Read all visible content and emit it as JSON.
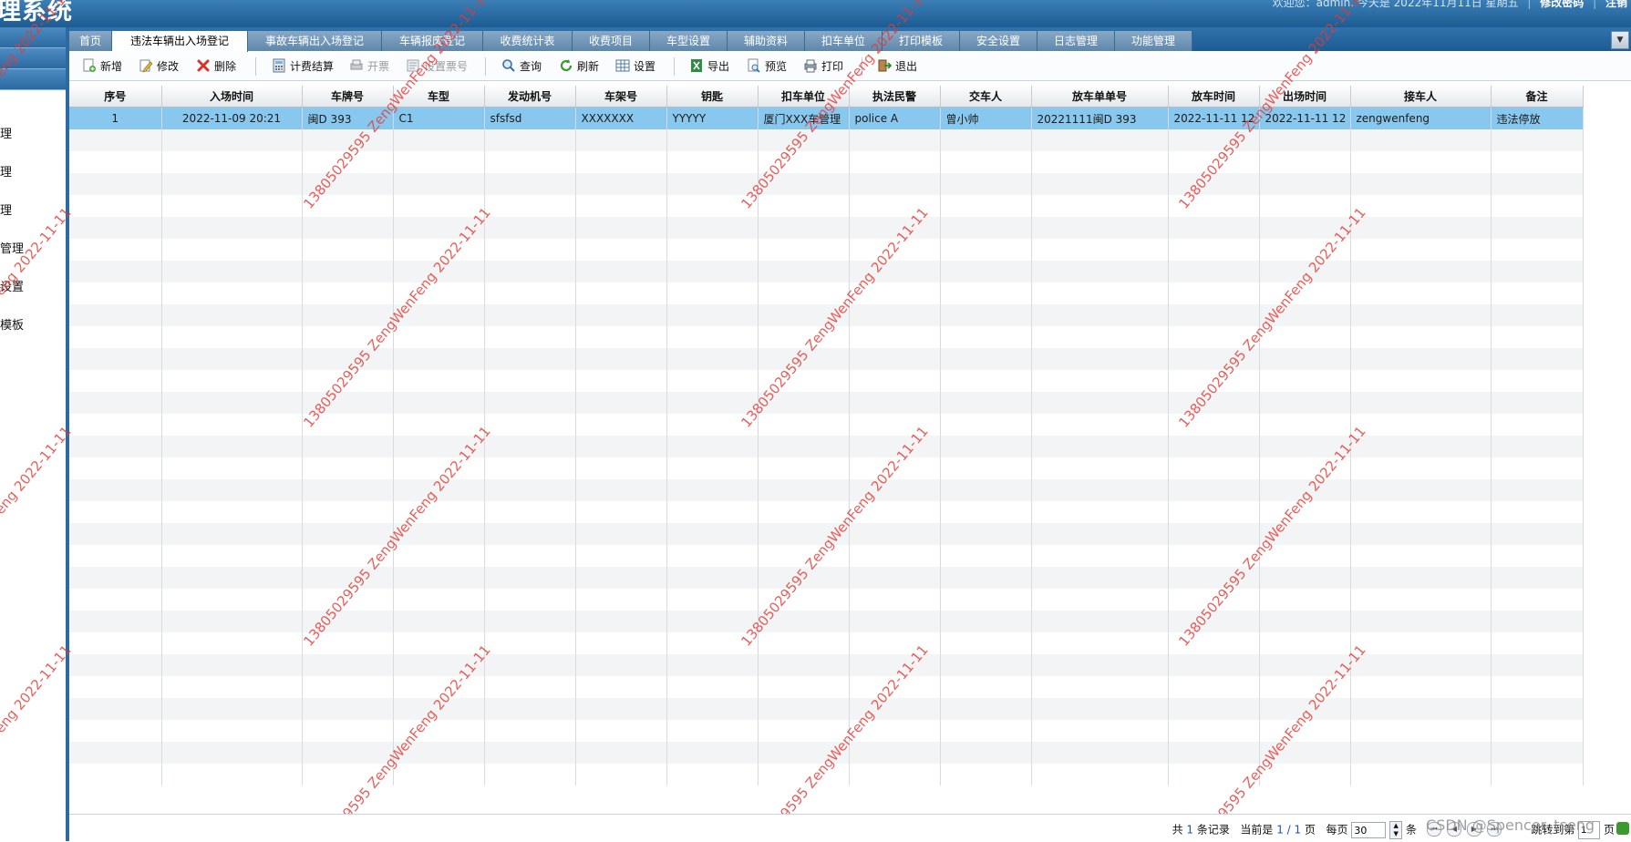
{
  "header": {
    "app_title": "理系统",
    "user_text": "欢迎您：admin. 今天是 2022年11月11日 星期五",
    "change_password": "修改密码",
    "logout": "注销"
  },
  "sidebar": {
    "items": [
      "理",
      "理",
      "理",
      "管理",
      "设置",
      "模板"
    ]
  },
  "tabs": [
    "首页",
    "违法车辆出入场登记",
    "事故车辆出入场登记",
    "车辆报废登记",
    "收费统计表",
    "收费项目",
    "车型设置",
    "辅助资料",
    "扣车单位",
    "打印模板",
    "安全设置",
    "日志管理",
    "功能管理"
  ],
  "active_tab_index": 1,
  "toolbar": {
    "add": "新增",
    "edit": "修改",
    "delete": "删除",
    "calc": "计费结算",
    "invoice": "开票",
    "set_invoice_no": "设置票号",
    "query": "查询",
    "refresh": "刷新",
    "settings": "设置",
    "export": "导出",
    "preview": "预览",
    "print": "打印",
    "exit": "退出"
  },
  "grid": {
    "columns": [
      "序号",
      "入场时间",
      "车牌号",
      "车型",
      "发动机号",
      "车架号",
      "钥匙",
      "扣车单位",
      "执法民警",
      "交车人",
      "放车单单号",
      "放车时间",
      "出场时间",
      "接车人",
      "备注"
    ],
    "rows": [
      [
        "1",
        "2022-11-09 20:21",
        "闽D 393",
        "C1",
        "sfsfsd",
        "XXXXXXX",
        "YYYYY",
        "厦门XXX车管理",
        "police A",
        "曾小帅",
        "20221111闽D 393",
        "2022-11-11 12",
        "2022-11-11 12",
        "zengwenfeng",
        "违法停放"
      ]
    ],
    "selected_row": 0
  },
  "watermark": {
    "text": "13805029595 ZengWenFeng 2022-11-11"
  },
  "pager": {
    "total_prefix": "共",
    "total": "1",
    "total_suffix": "条记录",
    "current_label": "当前是",
    "current_page": "1",
    "page_sep": "/",
    "page_count": "1",
    "page_unit": "页",
    "per_page_label": "每页",
    "per_page_value": "30",
    "per_page_unit": "条",
    "goto_label": "跳转到第",
    "goto_value": "1",
    "goto_unit": "页",
    "csdn_mark": "CSDN @Spencer_tseng"
  },
  "colors": {
    "banner": "#1d5c93",
    "selected_row": "#89c8ee",
    "watermark": "#e53935"
  }
}
